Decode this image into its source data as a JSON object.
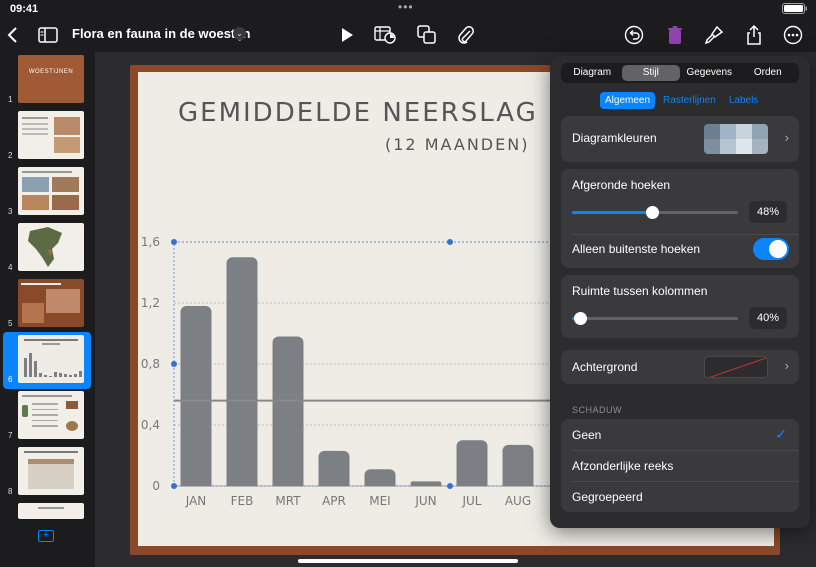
{
  "status": {
    "time": "09:41",
    "dots": "•••",
    "battery": "100%"
  },
  "toolbar": {
    "title": "Flora en fauna in de woestijn",
    "icons": [
      "back-icon",
      "sidebar-icon",
      "play-icon",
      "table-chart-icon",
      "shapes-icon",
      "attachment-icon",
      "undo-icon",
      "trash-icon",
      "format-brush-icon",
      "share-icon",
      "more-icon"
    ]
  },
  "slides": [
    {
      "num": "1",
      "label": "WOESTIJNEN"
    },
    {
      "num": "2"
    },
    {
      "num": "3"
    },
    {
      "num": "4"
    },
    {
      "num": "5"
    },
    {
      "num": "6"
    },
    {
      "num": "7"
    },
    {
      "num": "8"
    }
  ],
  "slide": {
    "title": "GEMIDDELDE NEERSLAG MOJ",
    "subtitle": "(12 MAANDEN)"
  },
  "chart_data": {
    "type": "bar",
    "categories": [
      "JAN",
      "FEB",
      "MRT",
      "APR",
      "MEI",
      "JUN",
      "JUL",
      "AUG"
    ],
    "values": [
      1.18,
      1.5,
      0.98,
      0.23,
      0.11,
      0.03,
      0.3,
      0.27
    ],
    "yticks": [
      "1,6",
      "1,2",
      "0,8",
      "0,4",
      "0"
    ],
    "ylim": [
      0,
      1.6
    ],
    "average_line": 0.56,
    "bar_color": "#7c8084"
  },
  "panel": {
    "tabs": [
      "Diagram",
      "Stijl",
      "Gegevens",
      "Orden"
    ],
    "active_tab": "Stijl",
    "subtabs": [
      "Algemeen",
      "Rasterlijnen",
      "Labels"
    ],
    "diagram_colors_label": "Diagramkleuren",
    "rounded_corners_label": "Afgeronde hoeken",
    "rounded_corners_value": "48%",
    "rounded_corners_level": 0.48,
    "outer_corners_label": "Alleen buitenste hoeken",
    "spacing_label": "Ruimte tussen kolommen",
    "spacing_value": "40%",
    "spacing_level": 0.05,
    "background_label": "Achtergrond",
    "shadow_header": "SCHADUW",
    "shadow_options": [
      "Geen",
      "Afzonderlijke reeks",
      "Gegroepeerd"
    ],
    "swatch_colors": [
      "#6a7f93",
      "#9fb4c6",
      "#c7d4de",
      "#8fa3b4",
      "#7d8f9f",
      "#b6c5d1",
      "#dfe6ec",
      "#a5b3bf"
    ]
  }
}
